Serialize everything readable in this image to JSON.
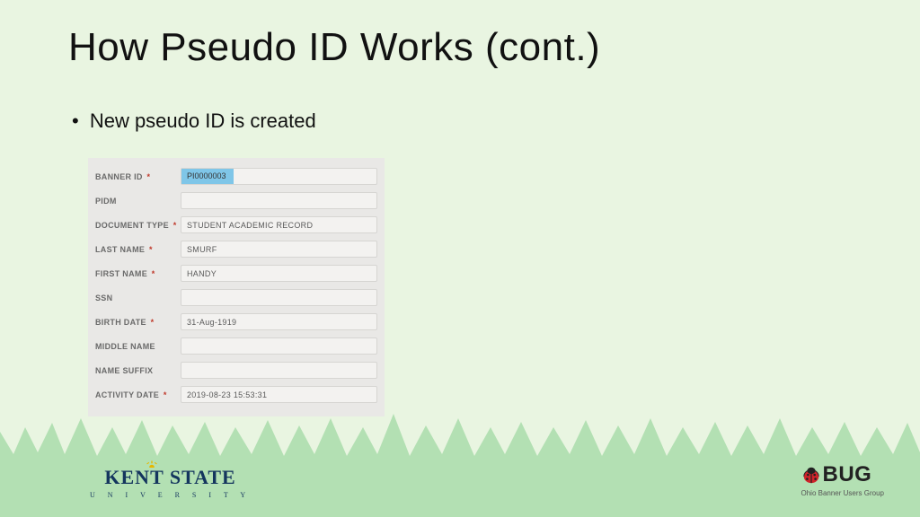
{
  "title": "How Pseudo ID Works (cont.)",
  "bullet": "New pseudo ID is created",
  "form": {
    "rows": [
      {
        "label": "BANNER ID",
        "required": true,
        "value": "PI0000003",
        "highlighted": true
      },
      {
        "label": "PIDM",
        "required": false,
        "value": ""
      },
      {
        "label": "DOCUMENT TYPE",
        "required": true,
        "value": "STUDENT ACADEMIC RECORD"
      },
      {
        "label": "LAST NAME",
        "required": true,
        "value": "SMURF"
      },
      {
        "label": "FIRST NAME",
        "required": true,
        "value": "HANDY"
      },
      {
        "label": "SSN",
        "required": false,
        "value": ""
      },
      {
        "label": "BIRTH DATE",
        "required": true,
        "value": "31-Aug-1919"
      },
      {
        "label": "MIDDLE NAME",
        "required": false,
        "value": ""
      },
      {
        "label": "NAME SUFFIX",
        "required": false,
        "value": ""
      },
      {
        "label": "ACTIVITY DATE",
        "required": true,
        "value": "2019-08-23 15:53:31"
      }
    ]
  },
  "logos": {
    "kent_main": "KENT STATE",
    "kent_sub": "U N I V E R S I T Y",
    "obug_main": "BUG",
    "obug_sub": "Ohio Banner Users Group"
  }
}
